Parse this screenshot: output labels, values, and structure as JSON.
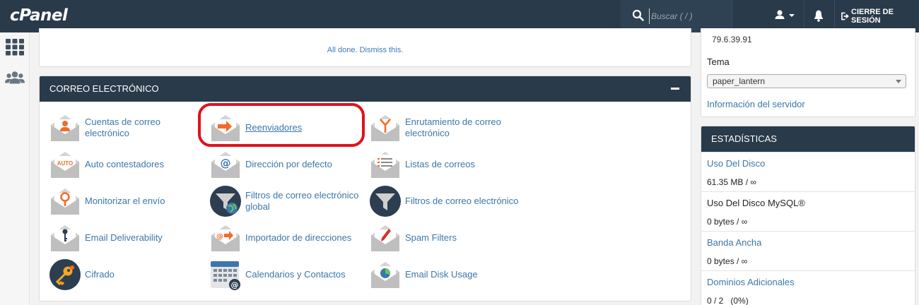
{
  "header": {
    "logo_text": "cPanel",
    "search_placeholder": "Buscar ( / )",
    "logout_label": "CIERRE DE SESIÓN"
  },
  "notice": {
    "text": "All done. Dismiss this."
  },
  "email_section": {
    "title": "CORREO ELECTRÓNICO",
    "items": [
      {
        "label": "Cuentas de correo electrónico",
        "icon": "envelope-user-icon"
      },
      {
        "label": "Reenviadores",
        "icon": "envelope-forward-arrow-icon"
      },
      {
        "label": "Enrutamiento de correo electrónico",
        "icon": "envelope-routing-icon"
      },
      {
        "label": "Auto contestadores",
        "icon": "envelope-auto-icon"
      },
      {
        "label": "Dirección por defecto",
        "icon": "envelope-at-icon"
      },
      {
        "label": "Listas de correos",
        "icon": "envelope-list-icon"
      },
      {
        "label": "Monitorizar el envío",
        "icon": "envelope-pin-icon"
      },
      {
        "label": "Filtros de correo electrónico global",
        "icon": "funnel-globe-icon"
      },
      {
        "label": "Filtros de correo electrónico",
        "icon": "funnel-icon"
      },
      {
        "label": "Email Deliverability",
        "icon": "envelope-key-icon"
      },
      {
        "label": "Importador de direcciones",
        "icon": "envelope-import-icon"
      },
      {
        "label": "Spam Filters",
        "icon": "envelope-pen-icon"
      },
      {
        "label": "Cifrado",
        "icon": "key-icon"
      },
      {
        "label": "Calendarios y Contactos",
        "icon": "calendar-icon"
      },
      {
        "label": "Email Disk Usage",
        "icon": "envelope-pie-icon"
      }
    ]
  },
  "sidebar_info": {
    "ip": "79.6.39.91",
    "theme_label": "Tema",
    "theme_value": "paper_lantern",
    "server_info_link": "Información del servidor"
  },
  "stats": {
    "title": "ESTADÍSTICAS",
    "rows": [
      {
        "name": "Uso Del Disco",
        "value": "61.35 MB / ∞"
      },
      {
        "name": "Uso Del Disco MySQL®",
        "value": "0 bytes / ∞"
      },
      {
        "name": "Banda Ancha",
        "value": "0 bytes / ∞"
      },
      {
        "name": "Dominios Adicionales",
        "value": "0 / 2   (0%)"
      }
    ]
  },
  "colors": {
    "navy": "#293a4a",
    "link": "#3b77ab",
    "accent_orange": "#f26b2a",
    "highlight_red": "#e0121b"
  }
}
